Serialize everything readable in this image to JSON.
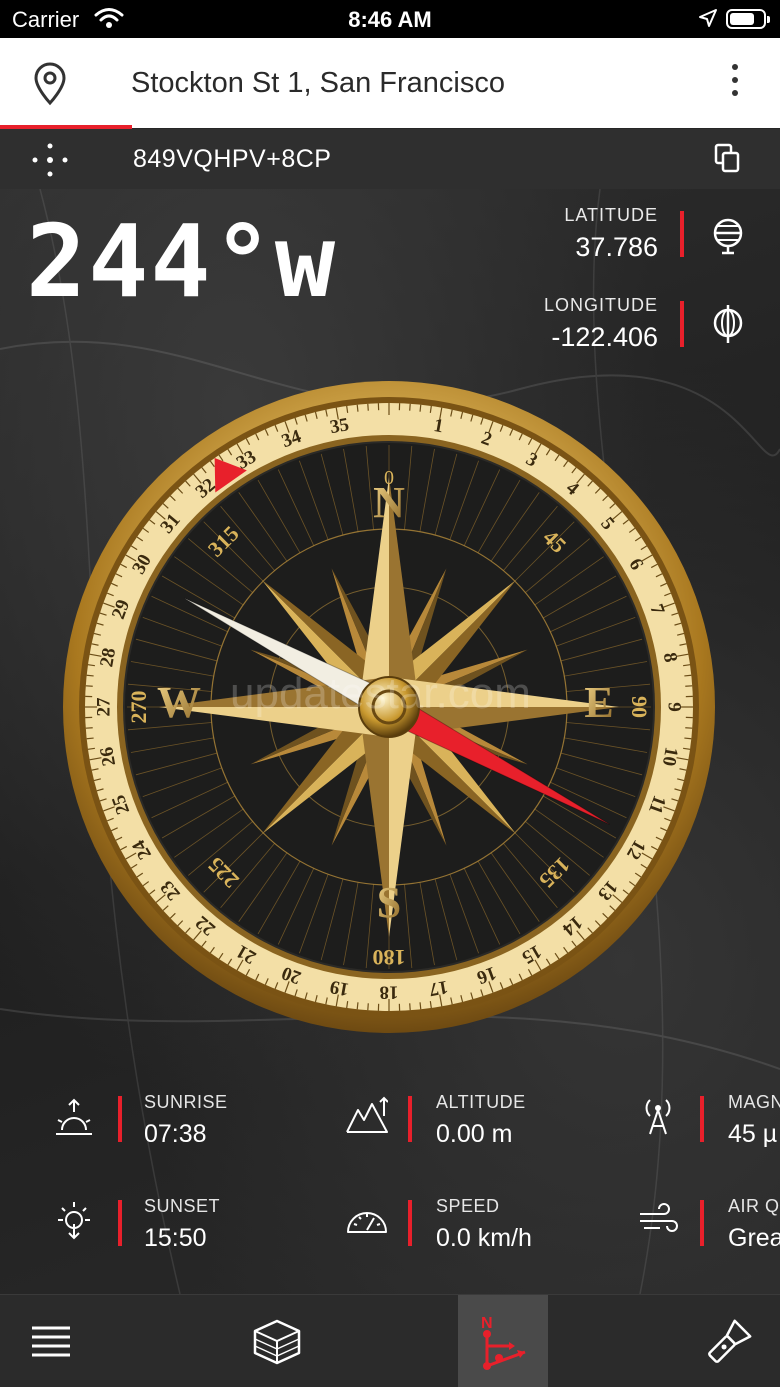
{
  "status_bar": {
    "carrier": "Carrier",
    "time": "8:46 AM"
  },
  "address_bar": {
    "address": "Stockton St 1, San Francisco"
  },
  "plus_code": {
    "code": "849VQHPV+8CP"
  },
  "heading": {
    "value": "244°w"
  },
  "coordinates": {
    "latitude_label": "LATITUDE",
    "latitude_value": "37.786",
    "longitude_label": "LONGITUDE",
    "longitude_value": "-122.406"
  },
  "compass": {
    "cardinals": {
      "n": "N",
      "e": "E",
      "s": "S",
      "w": "W"
    },
    "inner_degrees": [
      "0",
      "45",
      "90",
      "135",
      "180",
      "225",
      "270",
      "315"
    ],
    "outer_numbers": [
      "1",
      "2",
      "3",
      "4",
      "5",
      "6",
      "7",
      "8",
      "9",
      "10",
      "11",
      "12",
      "13",
      "14",
      "15",
      "16",
      "17",
      "18",
      "19",
      "20",
      "21",
      "22",
      "23",
      "24",
      "25",
      "26",
      "27",
      "28",
      "29",
      "30",
      "31",
      "32",
      "33",
      "34",
      "35"
    ],
    "needle_heading_deg": 244,
    "bezel_marker_deg": 325,
    "watermark": "updatestar.com",
    "colors": {
      "gold": "#d9b35a",
      "needle_red": "#e8202b",
      "needle_white": "#f2eee2"
    }
  },
  "info": {
    "sunrise_label": "SUNRISE",
    "sunrise_value": "07:38",
    "altitude_label": "ALTITUDE",
    "altitude_value": "0.00 m",
    "magnetic_label": "MAGN",
    "magnetic_value": "45 µ",
    "sunset_label": "SUNSET",
    "sunset_value": "15:50",
    "speed_label": "SPEED",
    "speed_value": "0.0 km/h",
    "air_label": "AIR Q",
    "air_value": "Grea"
  },
  "colors": {
    "accent": "#e8202b",
    "bar_bg": "#2f2f2f",
    "nav_active": "#4a4a4a"
  }
}
